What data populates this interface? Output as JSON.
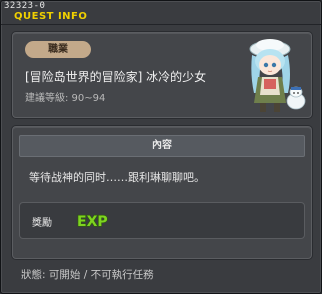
{
  "window": {
    "id_label": "32323-0",
    "title": "QUEST INFO"
  },
  "job": {
    "label": "職業"
  },
  "quest": {
    "name": "[冒险岛世界的冒险家] 冰冷的少女",
    "level_req": "建議等級: 90~94"
  },
  "content": {
    "header": "內容",
    "text": "等待战神的同时……跟利琳聊聊吧。"
  },
  "reward": {
    "label": "獎勵",
    "exp_text": "EXP"
  },
  "status": {
    "text": "狀態: 可開始 / 不可執行任務"
  },
  "colors": {
    "title": "#f0d000",
    "exp_green": "#7ed321"
  },
  "icons": {
    "npc": "npc-girl-portrait",
    "exp": "exp-icon"
  }
}
